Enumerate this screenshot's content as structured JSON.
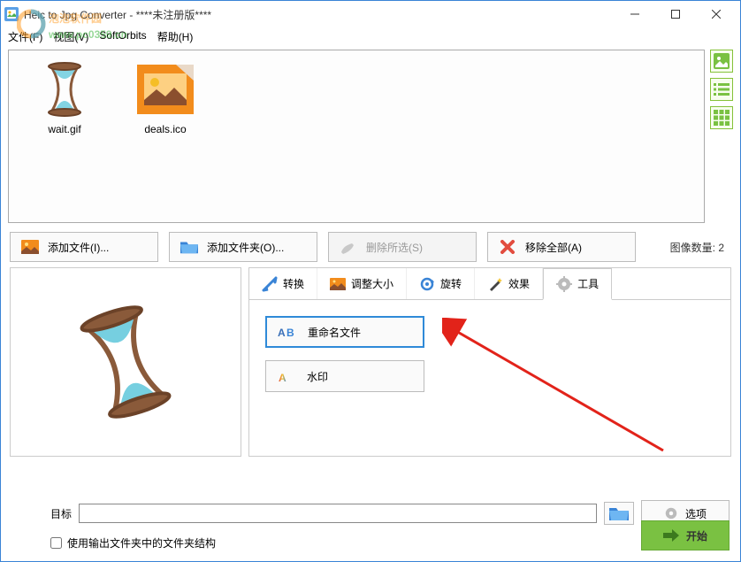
{
  "window": {
    "title": "Heic to Jpg Converter - ****未注册版****"
  },
  "watermark": {
    "line1": "泡泡软件园",
    "line2": "www.pc0359.cn"
  },
  "menu": {
    "file": "文件(F)",
    "view": "视图(V)",
    "softorbits": "SoftOrbits",
    "help": "帮助(H)"
  },
  "thumbs": [
    {
      "label": "wait.gif"
    },
    {
      "label": "deals.ico"
    }
  ],
  "toolbar": {
    "add_file": "添加文件(I)...",
    "add_folder": "添加文件夹(O)...",
    "remove_sel": "删除所选(S)",
    "remove_all": "移除全部(A)",
    "count_label": "图像数量:",
    "count_value": "2"
  },
  "tabs": {
    "convert": "转换",
    "resize": "调整大小",
    "rotate": "旋转",
    "effects": "效果",
    "tools": "工具"
  },
  "tools_panel": {
    "rename": "重命名文件",
    "watermark": "水印"
  },
  "bottom": {
    "dest_label": "目标",
    "options": "选项",
    "start": "开始",
    "use_structure": "使用输出文件夹中的文件夹结构"
  }
}
